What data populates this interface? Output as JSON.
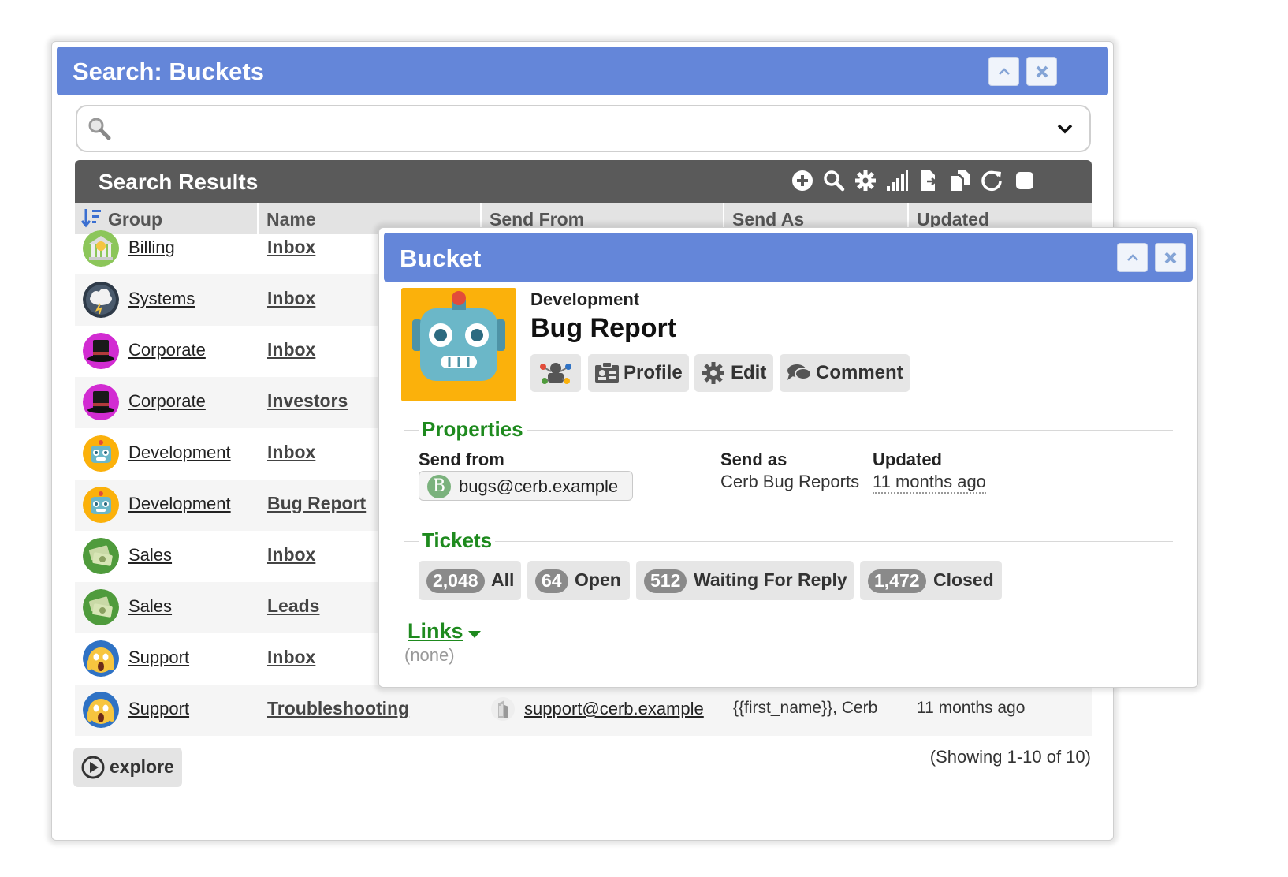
{
  "search_panel": {
    "title": "Search: Buckets",
    "search": {
      "value": "",
      "placeholder": ""
    },
    "results": {
      "title": "Search Results",
      "tools": [
        "add-icon",
        "search-icon",
        "gear-icon",
        "chart-icon",
        "export-icon",
        "copy-icon",
        "refresh-icon",
        "checkbox-icon"
      ],
      "columns": [
        "Group",
        "Name",
        "Send From",
        "Send As",
        "Updated"
      ],
      "rows": [
        {
          "group": "Billing",
          "name": "Inbox",
          "avatar": "bank-icon",
          "send_from": "",
          "send_as": "",
          "updated": ""
        },
        {
          "group": "Systems",
          "name": "Inbox",
          "avatar": "storm-cloud-icon",
          "send_from": "",
          "send_as": "",
          "updated": ""
        },
        {
          "group": "Corporate",
          "name": "Inbox",
          "avatar": "top-hat-icon",
          "send_from": "",
          "send_as": "",
          "updated": ""
        },
        {
          "group": "Corporate",
          "name": "Investors",
          "avatar": "top-hat-icon",
          "send_from": "",
          "send_as": "",
          "updated": ""
        },
        {
          "group": "Development",
          "name": "Inbox",
          "avatar": "robot-icon",
          "send_from": "",
          "send_as": "",
          "updated": ""
        },
        {
          "group": "Development",
          "name": "Bug Report",
          "avatar": "robot-icon",
          "send_from": "",
          "send_as": "",
          "updated": ""
        },
        {
          "group": "Sales",
          "name": "Inbox",
          "avatar": "money-icon",
          "send_from": "",
          "send_as": "",
          "updated": ""
        },
        {
          "group": "Sales",
          "name": "Leads",
          "avatar": "money-icon",
          "send_from": "",
          "send_as": "",
          "updated": ""
        },
        {
          "group": "Support",
          "name": "Inbox",
          "avatar": "scream-face-icon",
          "send_from": "",
          "send_as": "",
          "updated": ""
        },
        {
          "group": "Support",
          "name": "Troubleshooting",
          "avatar": "scream-face-icon",
          "send_from": "support@cerb.example",
          "send_as": "{{first_name}}, Cerb",
          "updated": "11 months ago"
        }
      ],
      "explore_label": "explore",
      "showing": "(Showing 1-10 of 10)"
    }
  },
  "bucket_panel": {
    "title": "Bucket",
    "group": "Development",
    "name": "Bug Report",
    "actions": {
      "profile": "Profile",
      "edit": "Edit",
      "comment": "Comment"
    },
    "properties": {
      "heading": "Properties",
      "send_from_label": "Send from",
      "send_from": "bugs@cerb.example",
      "send_from_badge": "B",
      "send_as_label": "Send as",
      "send_as": "Cerb Bug Reports",
      "updated_label": "Updated",
      "updated": "11 months ago"
    },
    "tickets": {
      "heading": "Tickets",
      "buttons": [
        {
          "count": "2,048",
          "label": "All"
        },
        {
          "count": "64",
          "label": "Open"
        },
        {
          "count": "512",
          "label": "Waiting For Reply"
        },
        {
          "count": "1,472",
          "label": "Closed"
        }
      ]
    },
    "links": {
      "heading": "Links",
      "value": "(none)"
    }
  },
  "colors": {
    "titlebar": "#6486d9",
    "results_bar": "#5a5a5a",
    "section": "#1e8a1e",
    "robot_bg": "#fbb10b"
  }
}
